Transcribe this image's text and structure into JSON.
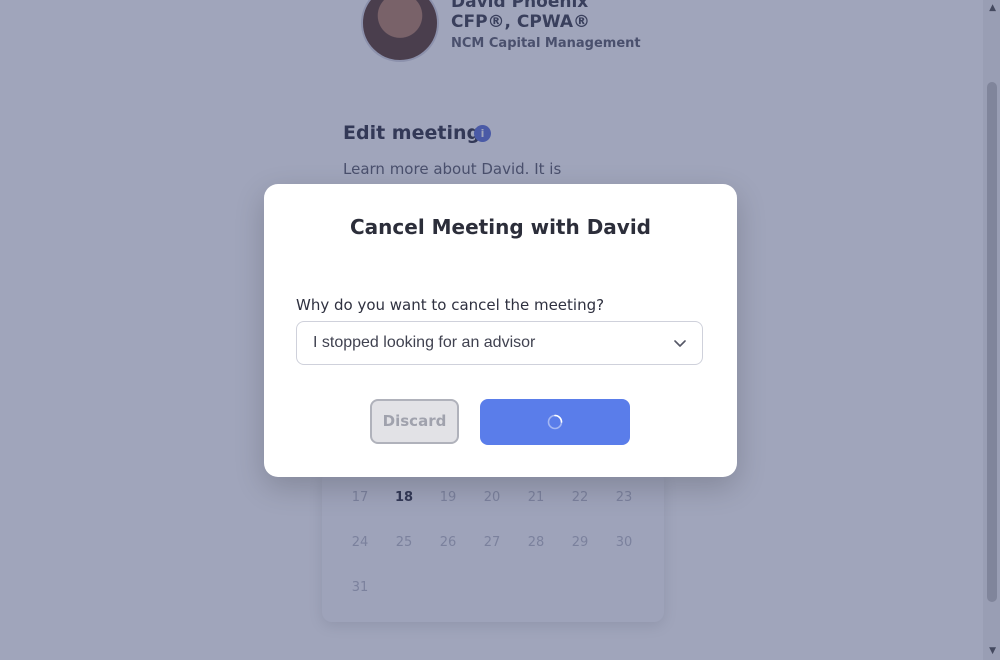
{
  "advisor": {
    "name": "David Phoenix",
    "credentials": "CFP®, CPWA®",
    "company": "NCM Capital Management"
  },
  "edit_section": {
    "title": "Edit meeting",
    "info_icon": "info-icon",
    "intro_text": "Learn more about David. It is"
  },
  "calendar": {
    "rows": [
      [
        "17",
        "18",
        "19",
        "20",
        "21",
        "22",
        "23"
      ],
      [
        "24",
        "25",
        "26",
        "27",
        "28",
        "29",
        "30"
      ],
      [
        "31"
      ]
    ],
    "highlighted_day": "18"
  },
  "modal": {
    "title": "Cancel Meeting with David",
    "question": "Why do you want to cancel the meeting?",
    "reason_selected": "I stopped looking for an advisor",
    "discard_label": "Discard",
    "confirm_state": "loading",
    "confirm_color": "#5a7dea"
  },
  "colors": {
    "overlay": "#394371",
    "accent": "#5b6fd6"
  }
}
